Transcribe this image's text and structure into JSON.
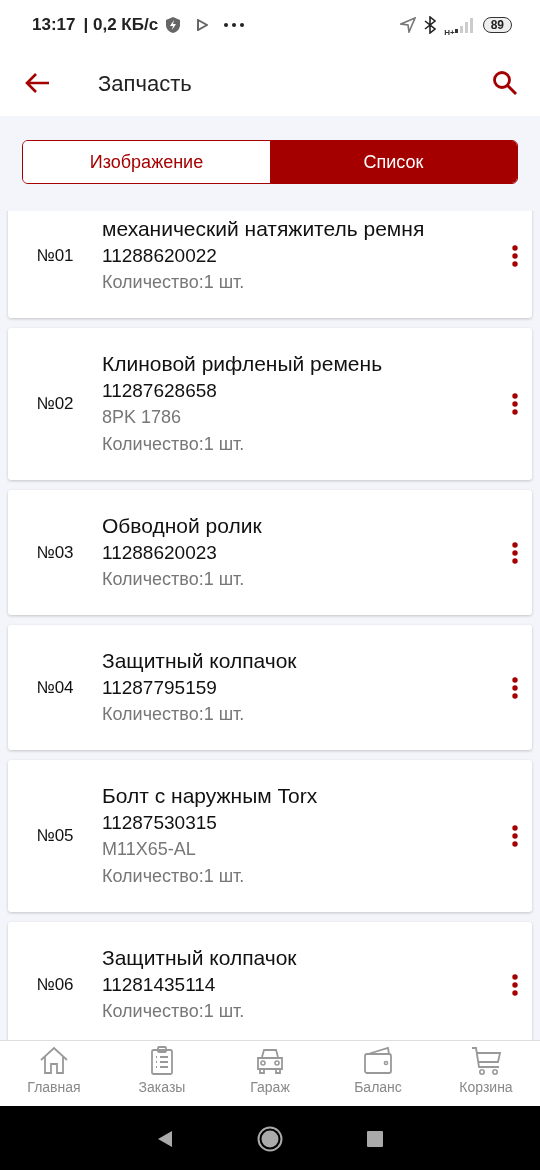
{
  "status_bar": {
    "time": "13:17",
    "speed": "| 0,2 КБ/с",
    "network_type": "H+",
    "battery": "89"
  },
  "header": {
    "title": "Запчасть"
  },
  "tabs": [
    {
      "label": "Изображение",
      "selected": false
    },
    {
      "label": "Список",
      "selected": true
    }
  ],
  "parts": [
    {
      "number": "№01",
      "title": "механический натяжитель ремня",
      "code": "11288620022",
      "quantity": "Количество:1 шт."
    },
    {
      "number": "№02",
      "title": "Клиновой рифленый ремень",
      "code": "11287628658",
      "note": "8PK 1786",
      "quantity": "Количество:1 шт."
    },
    {
      "number": "№03",
      "title": "Обводной ролик",
      "code": "11288620023",
      "quantity": "Количество:1 шт."
    },
    {
      "number": "№04",
      "title": "Защитный колпачок",
      "code": "11287795159",
      "quantity": "Количество:1 шт."
    },
    {
      "number": "№05",
      "title": "Болт с наружным Torx",
      "code": "11287530315",
      "note": "M11X65-AL",
      "quantity": "Количество:1 шт."
    },
    {
      "number": "№06",
      "title": "Защитный колпачок",
      "code": "11281435114",
      "quantity": "Количество:1 шт."
    }
  ],
  "bottom_nav": [
    {
      "kind": "home",
      "label": "Главная",
      "selected": false
    },
    {
      "kind": "orders",
      "label": "Заказы",
      "selected": false
    },
    {
      "kind": "garage",
      "label": "Гараж",
      "selected": false
    },
    {
      "kind": "balance",
      "label": "Баланс",
      "selected": false
    },
    {
      "kind": "cart",
      "label": "Корзина",
      "selected": false
    }
  ]
}
